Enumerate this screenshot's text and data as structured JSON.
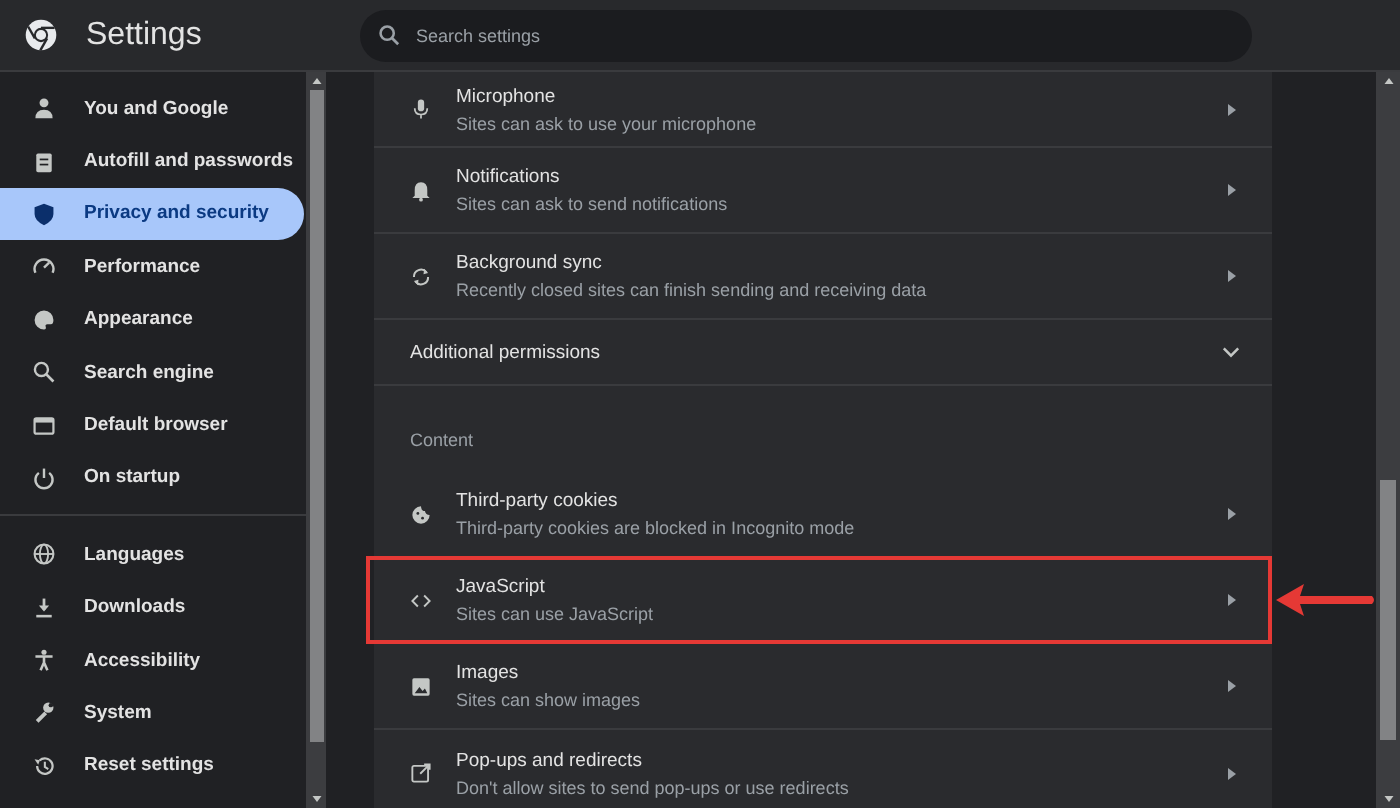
{
  "header": {
    "title": "Settings",
    "search": {
      "placeholder": "Search settings"
    }
  },
  "sidebar": {
    "groups": [
      {
        "items": [
          {
            "label": "You and Google",
            "selected": false
          },
          {
            "label": "Autofill and passwords",
            "selected": false
          },
          {
            "label": "Privacy and security",
            "selected": true
          },
          {
            "label": "Performance",
            "selected": false
          },
          {
            "label": "Appearance",
            "selected": false
          },
          {
            "label": "Search engine",
            "selected": false
          },
          {
            "label": "Default browser",
            "selected": false
          },
          {
            "label": "On startup",
            "selected": false
          }
        ]
      },
      {
        "items": [
          {
            "label": "Languages",
            "selected": false
          },
          {
            "label": "Downloads",
            "selected": false
          },
          {
            "label": "Accessibility",
            "selected": false
          },
          {
            "label": "System",
            "selected": false
          },
          {
            "label": "Reset settings",
            "selected": false
          }
        ]
      }
    ]
  },
  "content": {
    "rows": [
      {
        "kind": "link",
        "title": "Microphone",
        "subtitle": "Sites can ask to use your microphone",
        "highlighted": false
      },
      {
        "kind": "link",
        "title": "Notifications",
        "subtitle": "Sites can ask to send notifications",
        "highlighted": false
      },
      {
        "kind": "link",
        "title": "Background sync",
        "subtitle": "Recently closed sites can finish sending and receiving data",
        "highlighted": false
      },
      {
        "kind": "expander",
        "title": "Additional permissions",
        "expanded": false
      },
      {
        "kind": "heading",
        "title": "Content"
      },
      {
        "kind": "link",
        "title": "Third-party cookies",
        "subtitle": "Third-party cookies are blocked in Incognito mode",
        "highlighted": false
      },
      {
        "kind": "link",
        "title": "JavaScript",
        "subtitle": "Sites can use JavaScript",
        "highlighted": true
      },
      {
        "kind": "link",
        "title": "Images",
        "subtitle": "Sites can show images",
        "highlighted": false
      },
      {
        "kind": "link",
        "title": "Pop-ups and redirects",
        "subtitle": "Don't allow sites to send pop-ups or use redirects",
        "highlighted": false
      }
    ]
  }
}
